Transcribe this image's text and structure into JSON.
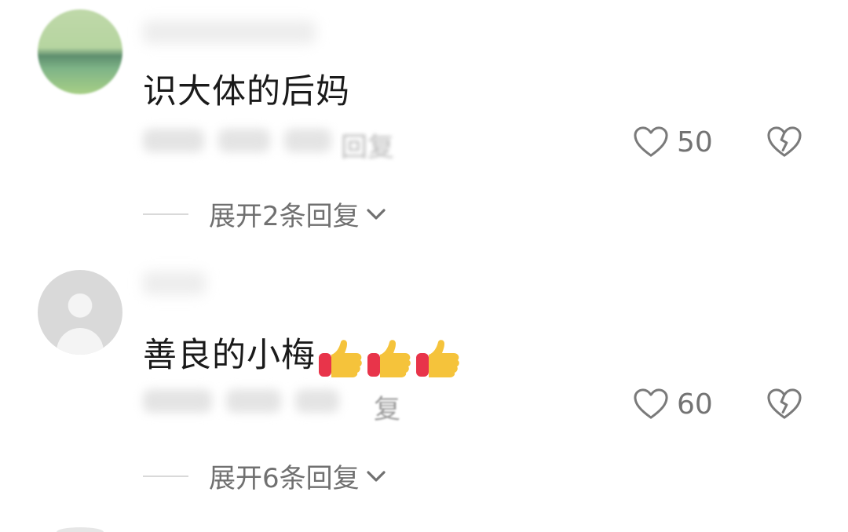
{
  "comments": [
    {
      "text": "识大体的后妈",
      "likes": "50",
      "meta_reply": "回复",
      "expand_label": "展开2条回复"
    },
    {
      "text": "善良的小梅",
      "emoji_name": "thumbs-up",
      "emoji_count": 3,
      "likes": "60",
      "meta_reply": "复",
      "expand_label": "展开6条回复"
    }
  ],
  "icons": {
    "like": "heart-outline-icon",
    "dislike": "broken-heart-icon",
    "expand": "chevron-down-icon"
  },
  "colors": {
    "text": "#1a1a1a",
    "secondary": "#737373",
    "thumb_yellow": "#f5c33b",
    "thumb_red": "#e8344a"
  }
}
